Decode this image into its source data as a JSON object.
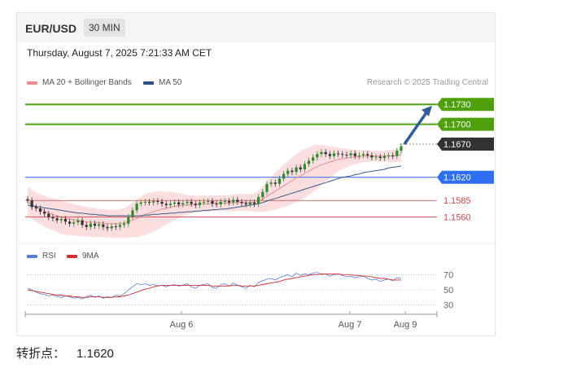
{
  "header": {
    "symbol": "EUR/USD",
    "timeframe": "30 MIN"
  },
  "datetime": "Thursday, August 7, 2025 7:21:33 AM CET",
  "legend": [
    {
      "label": "MA 20 + Bollinger Bands",
      "color": "#f08a8f"
    },
    {
      "label": "MA 50",
      "color": "#2f4f7f"
    }
  ],
  "research": "Research © 2025 Trading Central",
  "colors": {
    "resistance": "#4ea10c",
    "pivot": "#2d6ff0",
    "support": "#d7454b",
    "last": "#333333",
    "ma50": "#3a5a8c",
    "ma20": "#e88e93",
    "band_fill": "#fbd6d8",
    "candle_up": "#2b8a2b",
    "candle_down": "#333333",
    "arrow": "#2f5d9a",
    "rsi": "#5b7bd5",
    "rsi_ma": "#d32f2f"
  },
  "chart_data": [
    {
      "type": "line",
      "title": "",
      "levels": [
        {
          "value": 1.173,
          "label": "1.1730",
          "kind": "resistance"
        },
        {
          "value": 1.17,
          "label": "1.1700",
          "kind": "resistance"
        },
        {
          "value": 1.167,
          "label": "1.1670",
          "kind": "last"
        },
        {
          "value": 1.162,
          "label": "1.1620",
          "kind": "pivot"
        },
        {
          "value": 1.1585,
          "label": "1.1585",
          "kind": "support"
        },
        {
          "value": 1.156,
          "label": "1.1560",
          "kind": "support"
        }
      ],
      "x_ticks": [
        "Aug 6",
        "Aug 7",
        "Aug 9"
      ],
      "ylim": [
        1.153,
        1.1745
      ],
      "close": [
        1.1585,
        1.1575,
        1.1573,
        1.1568,
        1.1565,
        1.156,
        1.1558,
        1.1555,
        1.1557,
        1.1553,
        1.155,
        1.1552,
        1.1555,
        1.1548,
        1.1545,
        1.155,
        1.1547,
        1.1549,
        1.1545,
        1.1543,
        1.1546,
        1.1545,
        1.1548,
        1.155,
        1.156,
        1.157,
        1.158,
        1.1582,
        1.1583,
        1.1582,
        1.1584,
        1.1583,
        1.158,
        1.1578,
        1.158,
        1.1582,
        1.1579,
        1.1581,
        1.1583,
        1.158,
        1.1578,
        1.1582,
        1.1583,
        1.1584,
        1.158,
        1.1579,
        1.1583,
        1.1584,
        1.1582,
        1.1586,
        1.1583,
        1.1581,
        1.1579,
        1.1582,
        1.158,
        1.159,
        1.1598,
        1.161,
        1.1612,
        1.161,
        1.1618,
        1.1625,
        1.163,
        1.1628,
        1.1635,
        1.1632,
        1.164,
        1.1645,
        1.165,
        1.1655,
        1.1658,
        1.1655,
        1.1652,
        1.1656,
        1.1655,
        1.1654,
        1.1653,
        1.1656,
        1.1652,
        1.1653,
        1.1655,
        1.1653,
        1.165,
        1.1651,
        1.1649,
        1.1652,
        1.1653,
        1.1652,
        1.166,
        1.1667
      ],
      "ma20": [
        1.1583,
        1.1579,
        1.1575,
        1.1572,
        1.1569,
        1.1566,
        1.1564,
        1.1562,
        1.156,
        1.1558,
        1.1557,
        1.1556,
        1.1555,
        1.1554,
        1.1553,
        1.1552,
        1.1552,
        1.1551,
        1.1551,
        1.155,
        1.155,
        1.155,
        1.155,
        1.1551,
        1.1553,
        1.1555,
        1.1558,
        1.1561,
        1.1564,
        1.1566,
        1.1568,
        1.157,
        1.1572,
        1.1573,
        1.1575,
        1.1576,
        1.1577,
        1.1578,
        1.1578,
        1.1579,
        1.1579,
        1.158,
        1.158,
        1.158,
        1.1581,
        1.1581,
        1.1581,
        1.1581,
        1.1581,
        1.1582,
        1.1582,
        1.1582,
        1.1582,
        1.1582,
        1.1582,
        1.1584,
        1.1587,
        1.1591,
        1.1595,
        1.1599,
        1.1603,
        1.1607,
        1.1611,
        1.1615,
        1.1619,
        1.1622,
        1.1626,
        1.1629,
        1.1633,
        1.1636,
        1.1639,
        1.1641,
        1.1643,
        1.1645,
        1.1647,
        1.1648,
        1.1649,
        1.165,
        1.1651,
        1.1651,
        1.1652,
        1.1652,
        1.1652,
        1.1652,
        1.1652,
        1.1652,
        1.1652,
        1.1652,
        1.1653,
        1.1654
      ],
      "ma50": [
        1.1578,
        1.1577,
        1.1576,
        1.1575,
        1.1574,
        1.1573,
        1.1572,
        1.1571,
        1.157,
        1.1569,
        1.1568,
        1.1567,
        1.1566,
        1.1566,
        1.1565,
        1.1564,
        1.1564,
        1.1563,
        1.1563,
        1.1562,
        1.1562,
        1.1562,
        1.1562,
        1.1562,
        1.1562,
        1.1562,
        1.1562,
        1.1562,
        1.1563,
        1.1563,
        1.1564,
        1.1564,
        1.1565,
        1.1565,
        1.1566,
        1.1566,
        1.1567,
        1.1567,
        1.1568,
        1.1568,
        1.1569,
        1.1569,
        1.157,
        1.157,
        1.1571,
        1.1571,
        1.1572,
        1.1572,
        1.1573,
        1.1574,
        1.1575,
        1.1576,
        1.1577,
        1.1578,
        1.1579,
        1.158,
        1.1582,
        1.1584,
        1.1586,
        1.1588,
        1.159,
        1.1592,
        1.1594,
        1.1596,
        1.1598,
        1.16,
        1.1602,
        1.1604,
        1.1606,
        1.1608,
        1.161,
        1.1612,
        1.1614,
        1.1616,
        1.1618,
        1.162,
        1.1621,
        1.1622,
        1.1624,
        1.1625,
        1.1627,
        1.1628,
        1.1629,
        1.163,
        1.1631,
        1.1632,
        1.1634,
        1.1635,
        1.1636,
        1.1637
      ],
      "band": [
        0.0022,
        0.0022,
        0.0022,
        0.0023,
        0.0023,
        0.0024,
        0.0024,
        0.0025,
        0.0025,
        0.0025,
        0.0024,
        0.0024,
        0.0023,
        0.0023,
        0.0022,
        0.0022,
        0.0022,
        0.0021,
        0.0021,
        0.0021,
        0.0021,
        0.0021,
        0.0022,
        0.0022,
        0.0024,
        0.0026,
        0.0028,
        0.003,
        0.0031,
        0.0031,
        0.003,
        0.0029,
        0.0027,
        0.0025,
        0.0023,
        0.0021,
        0.0019,
        0.0017,
        0.0015,
        0.0014,
        0.0013,
        0.0012,
        0.0012,
        0.0012,
        0.0012,
        0.0012,
        0.0012,
        0.0012,
        0.0012,
        0.0013,
        0.0013,
        0.0013,
        0.0013,
        0.0013,
        0.0014,
        0.0016,
        0.0019,
        0.0022,
        0.0025,
        0.0028,
        0.003,
        0.0032,
        0.0034,
        0.0035,
        0.0036,
        0.0037,
        0.0037,
        0.0036,
        0.0035,
        0.0033,
        0.003,
        0.0027,
        0.0024,
        0.0021,
        0.0018,
        0.0016,
        0.0014,
        0.0012,
        0.0011,
        0.001,
        0.0009,
        0.0009,
        0.0008,
        0.0008,
        0.0008,
        0.0008,
        0.0009,
        0.0009,
        0.001,
        0.0011
      ]
    },
    {
      "type": "line",
      "title": "",
      "legend": [
        {
          "label": "RSI",
          "color": "#5b7bd5"
        },
        {
          "label": "9MA",
          "color": "#d32f2f"
        }
      ],
      "ylim": [
        20,
        80
      ],
      "y_ticks": [
        70,
        50,
        30
      ],
      "series": [
        {
          "name": "RSI",
          "values": [
            52,
            50,
            47,
            45,
            44,
            42,
            43,
            41,
            40,
            42,
            41,
            39,
            40,
            38,
            41,
            43,
            40,
            42,
            39,
            41,
            40,
            43,
            42,
            45,
            50,
            54,
            58,
            57,
            58,
            56,
            57,
            55,
            56,
            54,
            56,
            57,
            55,
            56,
            58,
            54,
            52,
            56,
            57,
            58,
            53,
            52,
            57,
            58,
            55,
            59,
            56,
            54,
            52,
            56,
            54,
            60,
            62,
            64,
            65,
            63,
            66,
            68,
            70,
            67,
            72,
            69,
            71,
            70,
            72,
            73,
            70,
            71,
            68,
            70,
            71,
            69,
            67,
            68,
            66,
            67,
            68,
            65,
            63,
            64,
            61,
            63,
            64,
            62,
            66,
            65
          ]
        },
        {
          "name": "9MA",
          "values": [
            50,
            49,
            48,
            47,
            46,
            45,
            44,
            43,
            43,
            42,
            42,
            41,
            41,
            40,
            40,
            41,
            41,
            41,
            40,
            40,
            40,
            41,
            41,
            42,
            43,
            45,
            47,
            49,
            51,
            52,
            54,
            55,
            56,
            56,
            56,
            56,
            56,
            56,
            56,
            56,
            56,
            56,
            56,
            56,
            55,
            55,
            55,
            55,
            55,
            56,
            56,
            55,
            55,
            55,
            55,
            56,
            57,
            58,
            59,
            60,
            61,
            63,
            64,
            65,
            66,
            67,
            68,
            69,
            70,
            70,
            71,
            71,
            71,
            71,
            71,
            70,
            70,
            70,
            69,
            69,
            68,
            68,
            67,
            66,
            65,
            65,
            64,
            63,
            63,
            63
          ]
        }
      ]
    }
  ],
  "pivot_text": {
    "label": "转折点：",
    "value": "1.1620"
  }
}
